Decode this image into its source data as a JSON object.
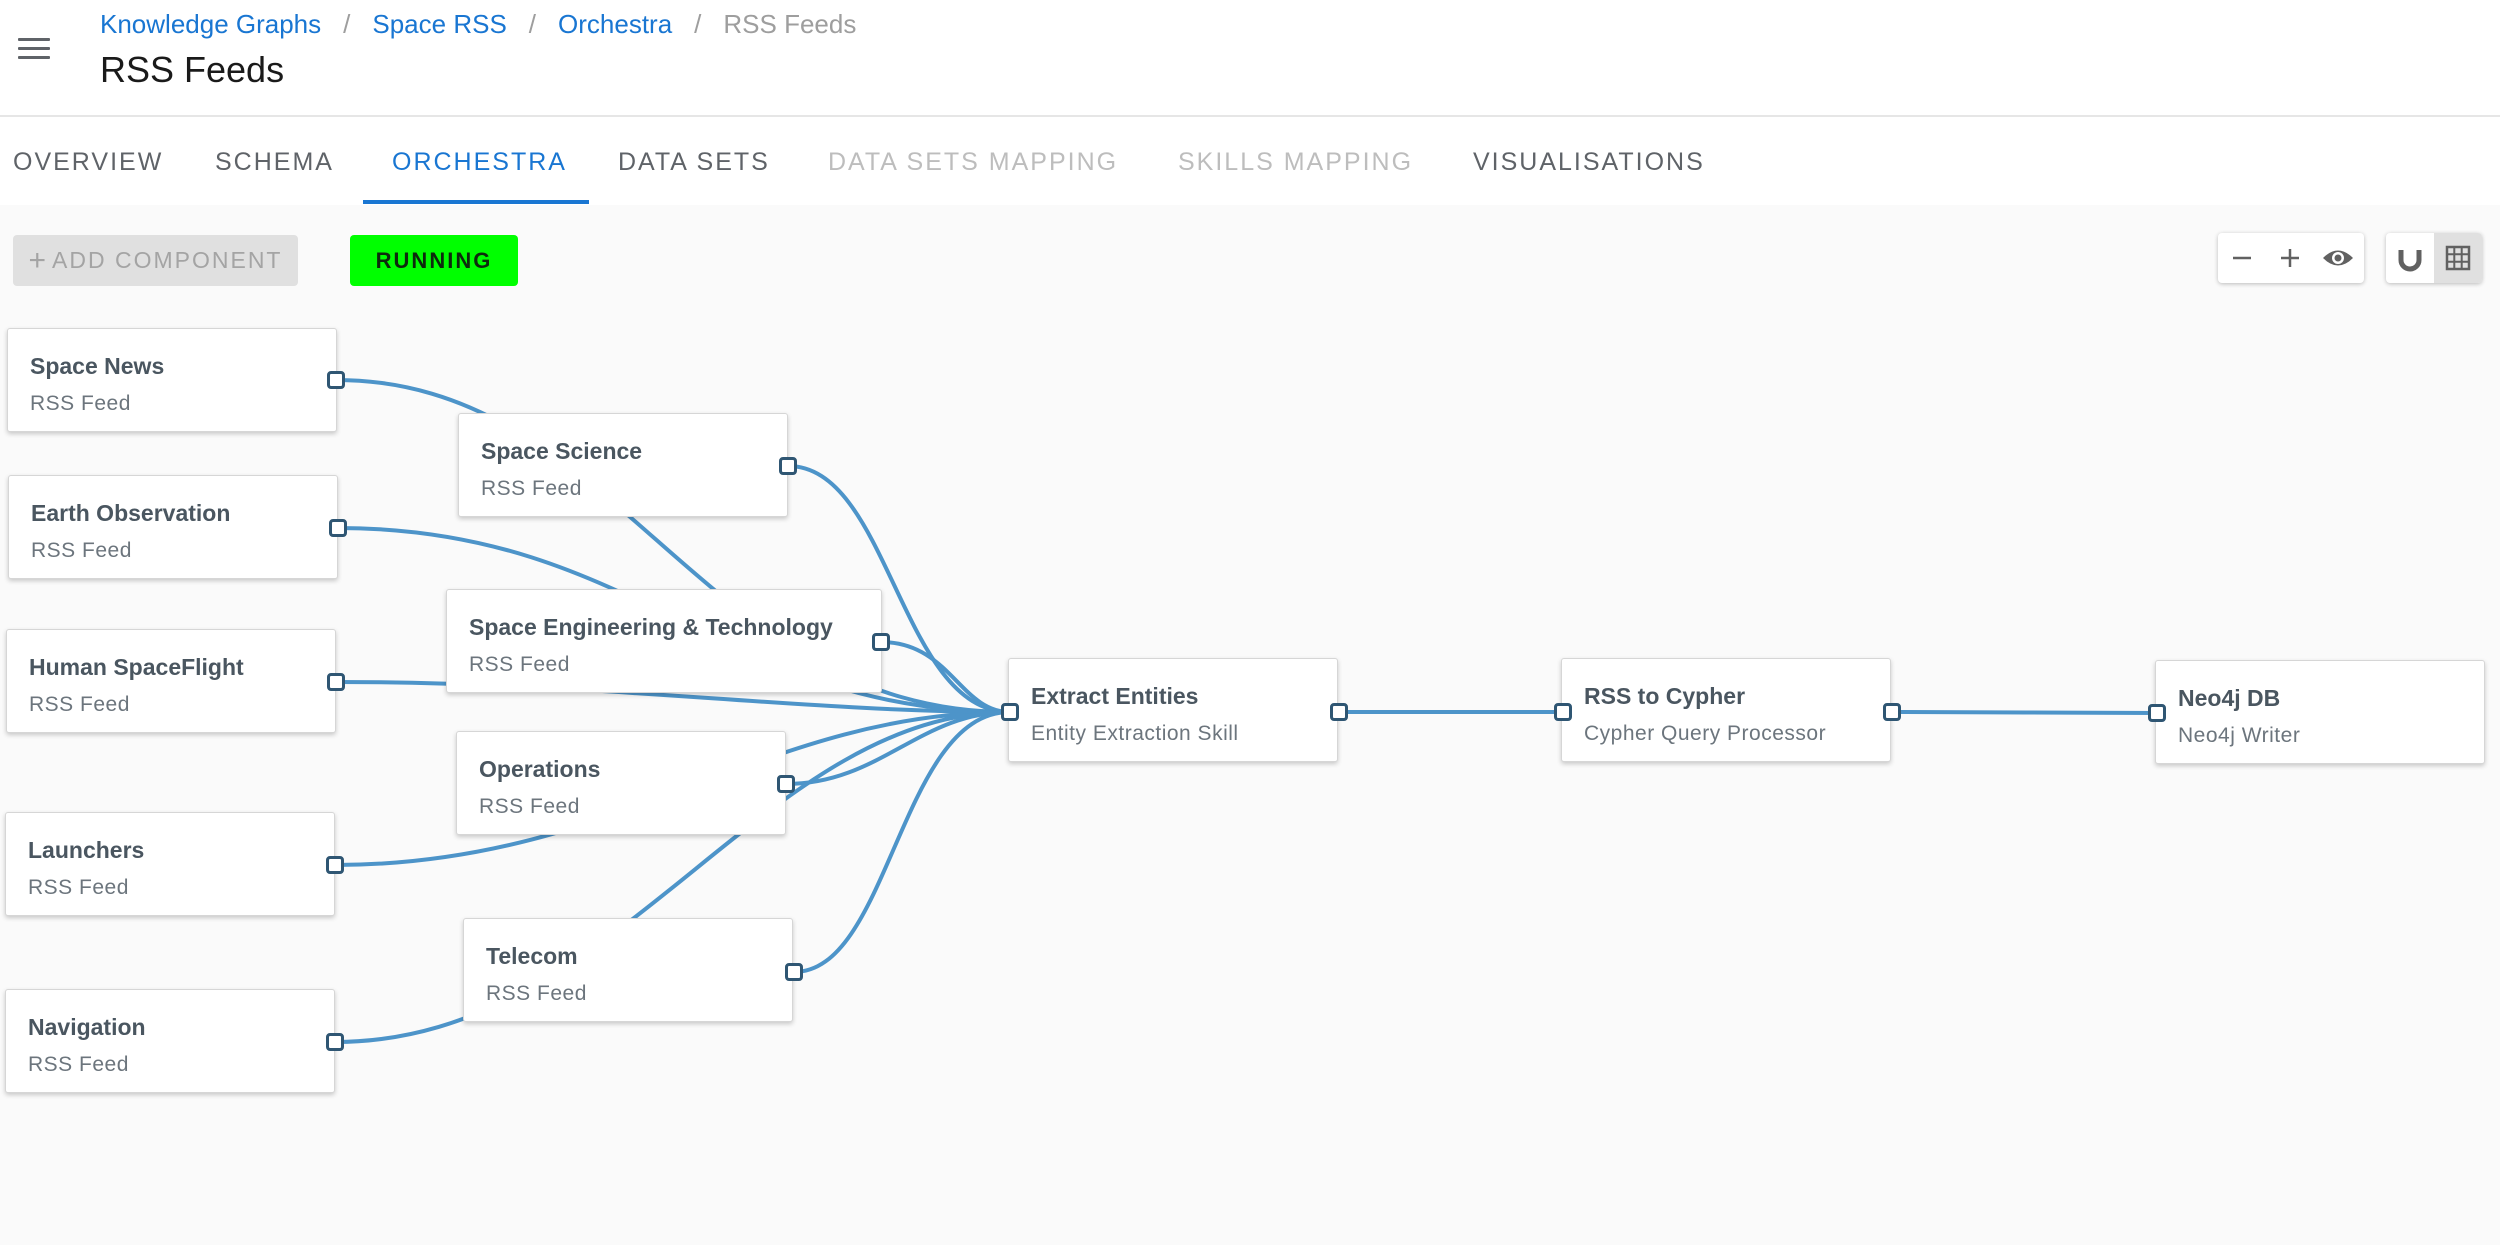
{
  "breadcrumb": {
    "items": [
      "Knowledge Graphs",
      "Space RSS",
      "Orchestra"
    ],
    "separator": "/",
    "current": "RSS Feeds"
  },
  "page_title": "RSS Feeds",
  "tabs": [
    {
      "label": "OVERVIEW",
      "state": "normal"
    },
    {
      "label": "SCHEMA",
      "state": "normal"
    },
    {
      "label": "ORCHESTRA",
      "state": "active"
    },
    {
      "label": "DATA SETS",
      "state": "normal"
    },
    {
      "label": "DATA SETS MAPPING",
      "state": "disabled"
    },
    {
      "label": "SKILLS MAPPING",
      "state": "disabled"
    },
    {
      "label": "VISUALISATIONS",
      "state": "normal"
    }
  ],
  "toolbar": {
    "add_component": "ADD COMPONENT",
    "status": "RUNNING",
    "zoom_out_icon": "minus-icon",
    "zoom_in_icon": "plus-icon",
    "preview_icon": "eye-icon",
    "snap_icon": "magnet-icon",
    "grid_icon": "grid-icon"
  },
  "nodes": [
    {
      "id": "space-news",
      "title": "Space News",
      "subtitle": "RSS Feed"
    },
    {
      "id": "space-science",
      "title": "Space Science",
      "subtitle": "RSS Feed"
    },
    {
      "id": "earth-observation",
      "title": "Earth Observation",
      "subtitle": "RSS Feed"
    },
    {
      "id": "space-engineering",
      "title": "Space Engineering & Technology",
      "subtitle": "RSS Feed"
    },
    {
      "id": "human-spaceflight",
      "title": "Human SpaceFlight",
      "subtitle": "RSS Feed"
    },
    {
      "id": "operations",
      "title": "Operations",
      "subtitle": "RSS Feed"
    },
    {
      "id": "launchers",
      "title": "Launchers",
      "subtitle": "RSS Feed"
    },
    {
      "id": "telecom",
      "title": "Telecom",
      "subtitle": "RSS Feed"
    },
    {
      "id": "navigation",
      "title": "Navigation",
      "subtitle": "RSS Feed"
    },
    {
      "id": "extract-entities",
      "title": "Extract Entities",
      "subtitle": "Entity Extraction Skill"
    },
    {
      "id": "rss-to-cypher",
      "title": "RSS to Cypher",
      "subtitle": "Cypher Query Processor"
    },
    {
      "id": "neo4j-db",
      "title": "Neo4j DB",
      "subtitle": "Neo4j Writer"
    }
  ],
  "colors": {
    "accent": "#1976d2",
    "running": "#00ff00",
    "edge": "#4d94c9",
    "port": "#2f5673"
  }
}
